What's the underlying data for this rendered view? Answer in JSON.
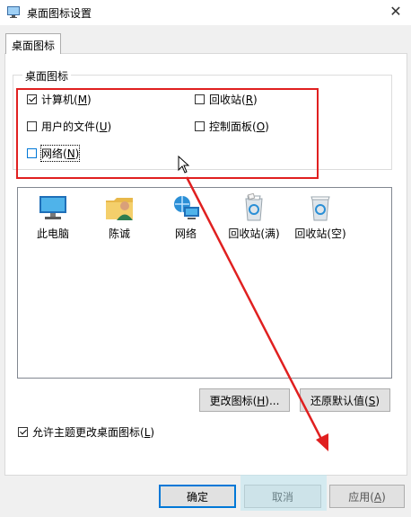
{
  "window": {
    "title": "桌面图标设置",
    "close_glyph": "✕"
  },
  "tab": {
    "label": "桌面图标"
  },
  "group": {
    "legend": "桌面图标"
  },
  "checkboxes": [
    {
      "text": "计算机(",
      "key": "M",
      "end": ")",
      "checked": true
    },
    {
      "text": "回收站(",
      "key": "R",
      "end": ")",
      "checked": false
    },
    {
      "text": "用户的文件(",
      "key": "U",
      "end": ")",
      "checked": false
    },
    {
      "text": "控制面板(",
      "key": "O",
      "end": ")",
      "checked": false
    },
    {
      "text": "网络(",
      "key": "N",
      "end": ")",
      "checked": false
    }
  ],
  "icons": [
    {
      "label": "此电脑",
      "icon": "computer-icon"
    },
    {
      "label": "陈诚",
      "icon": "user-folder-icon"
    },
    {
      "label": "网络",
      "icon": "network-icon"
    },
    {
      "label": "回收站(满)",
      "icon": "recycle-bin-full-icon"
    },
    {
      "label": "回收站(空)",
      "icon": "recycle-bin-empty-icon"
    }
  ],
  "buttons": {
    "change_icon": {
      "text": "更改图标(",
      "key": "H",
      "end": ")..."
    },
    "restore_default": {
      "text": "还原默认值(",
      "key": "S",
      "end": ")"
    },
    "ok": "确定",
    "cancel": "取消",
    "apply": {
      "text": "应用(",
      "key": "A",
      "end": ")"
    }
  },
  "allow_themes": {
    "text": "允许主题更改桌面图标(",
    "key": "L",
    "end": ")",
    "checked": true
  },
  "colors": {
    "annotation_red": "#e02020",
    "focus_blue": "#0078d7"
  }
}
